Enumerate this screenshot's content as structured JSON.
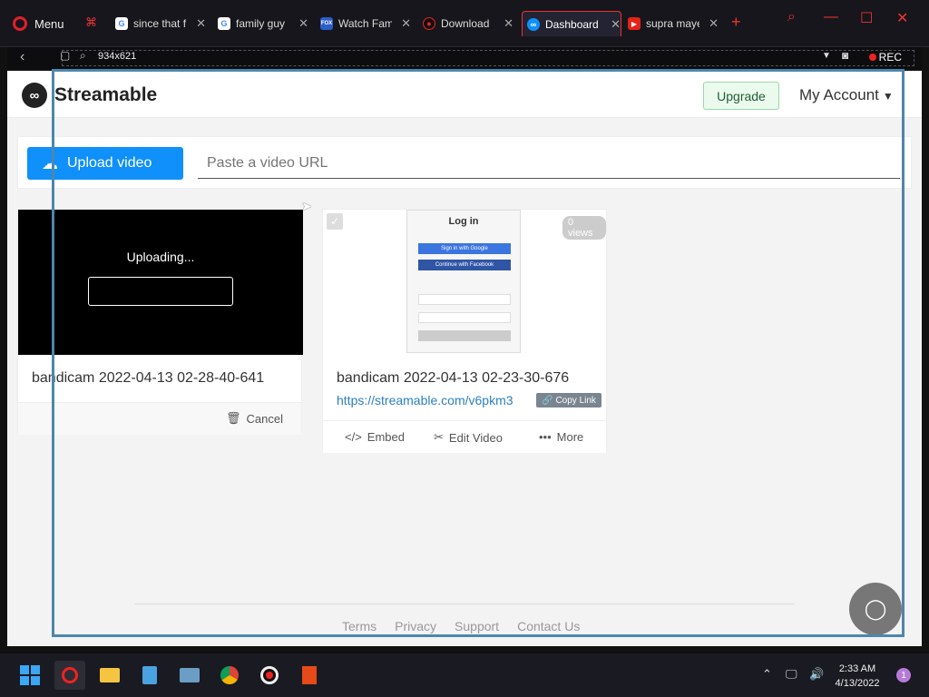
{
  "browser": {
    "menu_label": "Menu",
    "tabs": [
      {
        "title": "since that f",
        "icon": "G",
        "color": "#ffffff",
        "text": "#4285f4"
      },
      {
        "title": "family guy",
        "icon": "G",
        "color": "#ffffff",
        "text": "#4285f4"
      },
      {
        "title": "Watch Fam",
        "icon": "FOX",
        "color": "#2a5ec9",
        "text": "#ffffff"
      },
      {
        "title": "Download",
        "icon": "●",
        "color": "#111111",
        "text": "#e22222"
      },
      {
        "title": "Dashboard",
        "icon": "∞",
        "color": "#0f90fa",
        "text": "#ffffff"
      },
      {
        "title": "supra maye",
        "icon": "▶",
        "color": "#e62117",
        "text": "#ffffff"
      }
    ],
    "tab_close": "✕",
    "new_tab": "+",
    "address": {
      "dimensions": "934x621",
      "rec": "REC"
    }
  },
  "header": {
    "brand": "Streamable",
    "upgrade": "Upgrade",
    "account": "My Account"
  },
  "upload": {
    "button": "Upload video",
    "placeholder": "Paste a video URL"
  },
  "videos": [
    {
      "title": "bandicam 2022-04-13 02-28-40-641",
      "status": "Uploading...",
      "cancel": "Cancel"
    },
    {
      "title": "bandicam 2022-04-13 02-23-30-676",
      "link": "https://streamable.com/v6pkm3",
      "copy": "Copy Link",
      "views": "0 views",
      "thumb": {
        "title": "Log in",
        "google": "Sign in with Google",
        "facebook": "Continue with Facebook"
      },
      "actions": {
        "embed": "Embed",
        "edit": "Edit Video",
        "more": "More"
      }
    }
  ],
  "footer": {
    "links": [
      "Terms",
      "Privacy",
      "Support",
      "Contact Us"
    ]
  },
  "taskbar": {
    "time": "2:33 AM",
    "date": "4/13/2022",
    "notifications": "1"
  }
}
